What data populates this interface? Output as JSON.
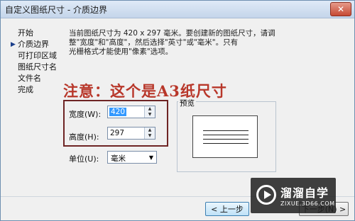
{
  "window": {
    "title": "自定义图纸尺寸 - 介质边界",
    "close_label": "✕"
  },
  "nav": {
    "items": [
      {
        "label": "开始",
        "current": false
      },
      {
        "label": "介质边界",
        "current": true
      },
      {
        "label": "可打印区域",
        "current": false
      },
      {
        "label": "图纸尺寸名",
        "current": false
      },
      {
        "label": "文件名",
        "current": false
      },
      {
        "label": "完成",
        "current": false
      }
    ],
    "current_marker": "▶"
  },
  "description": {
    "line1": "当前图纸尺寸为 420 x 297 毫米。要创建新的图纸尺寸，请调",
    "line2": "整\"宽度\"和\"高度\"，然后选择\"英寸\"或\"毫米\"。只有",
    "line3": "光栅格式才能使用\"像素\"选项。"
  },
  "annotation": {
    "note": "注意：这个是A3纸尺寸"
  },
  "form": {
    "width_label": "宽度(W):",
    "width_value": "420",
    "height_label": "高度(H):",
    "height_value": "297",
    "unit_label": "单位(U):",
    "unit_value": "毫米"
  },
  "preview": {
    "label": "预览"
  },
  "buttons": {
    "back": "< 上一步(B)",
    "next": "下一步(N) >"
  },
  "watermark": {
    "cn": "溜溜自学",
    "en": "ZIXUE.3D66.COM"
  },
  "colors": {
    "note": "#b8372a",
    "highlight_border": "#6e2424",
    "selection": "#3399ff"
  }
}
